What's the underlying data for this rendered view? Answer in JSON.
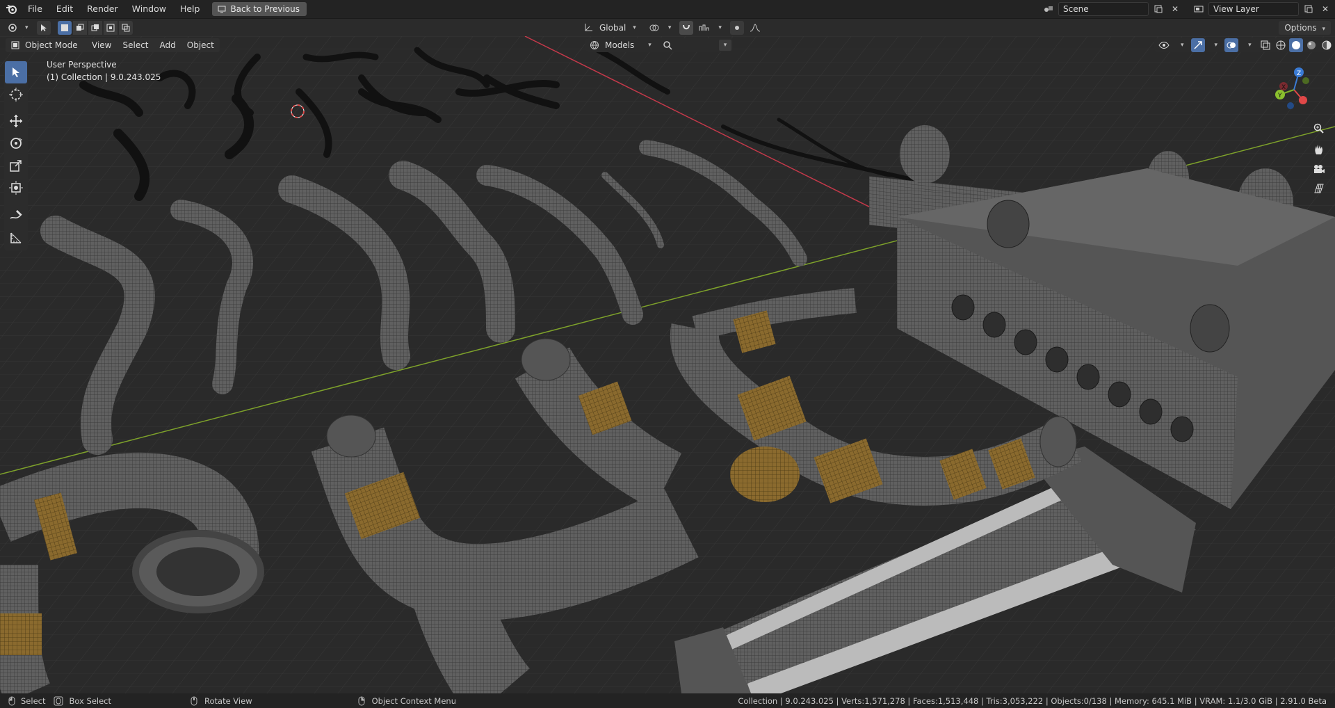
{
  "menus": [
    "File",
    "Edit",
    "Render",
    "Window",
    "Help"
  ],
  "back_button": "Back to Previous",
  "scene": {
    "label": "Scene"
  },
  "view_layer": {
    "label": "View Layer"
  },
  "toolbar": {
    "transform_orientation": "Global",
    "models_label": "Models",
    "options_label": "Options"
  },
  "viewport_header": {
    "mode": "Object Mode",
    "menus": [
      "View",
      "Select",
      "Add",
      "Object"
    ]
  },
  "viewport": {
    "perspective": "User Perspective",
    "collection": "(1) Collection | 9.0.243.025"
  },
  "statusbar": {
    "select": "Select",
    "box_select": "Box Select",
    "rotate_view": "Rotate View",
    "context_menu": "Object Context Menu",
    "stats": "Collection | 9.0.243.025 | Verts:1,571,278 | Faces:1,513,448 | Tris:3,053,222 | Objects:0/138 | Memory: 645.1 MiB | VRAM: 1.1/3.0 GiB | 2.91.0 Beta"
  },
  "colors": {
    "accent": "#4b6fa5",
    "grid_red": "#c4394a",
    "grid_green": "#7ea22a",
    "brass": "#8a6a2e",
    "metal": "#5b5b5b"
  },
  "icons": [
    "blender-logo-icon",
    "select-tool-icon",
    "cursor-tool-icon",
    "move-tool-icon",
    "rotate-tool-icon",
    "scale-tool-icon",
    "transform-tool-icon",
    "annotate-tool-icon",
    "measure-tool-icon",
    "zoom-icon",
    "hand-pan-icon",
    "camera-icon",
    "grid-ortho-icon",
    "search-icon",
    "gizmo-icon"
  ]
}
